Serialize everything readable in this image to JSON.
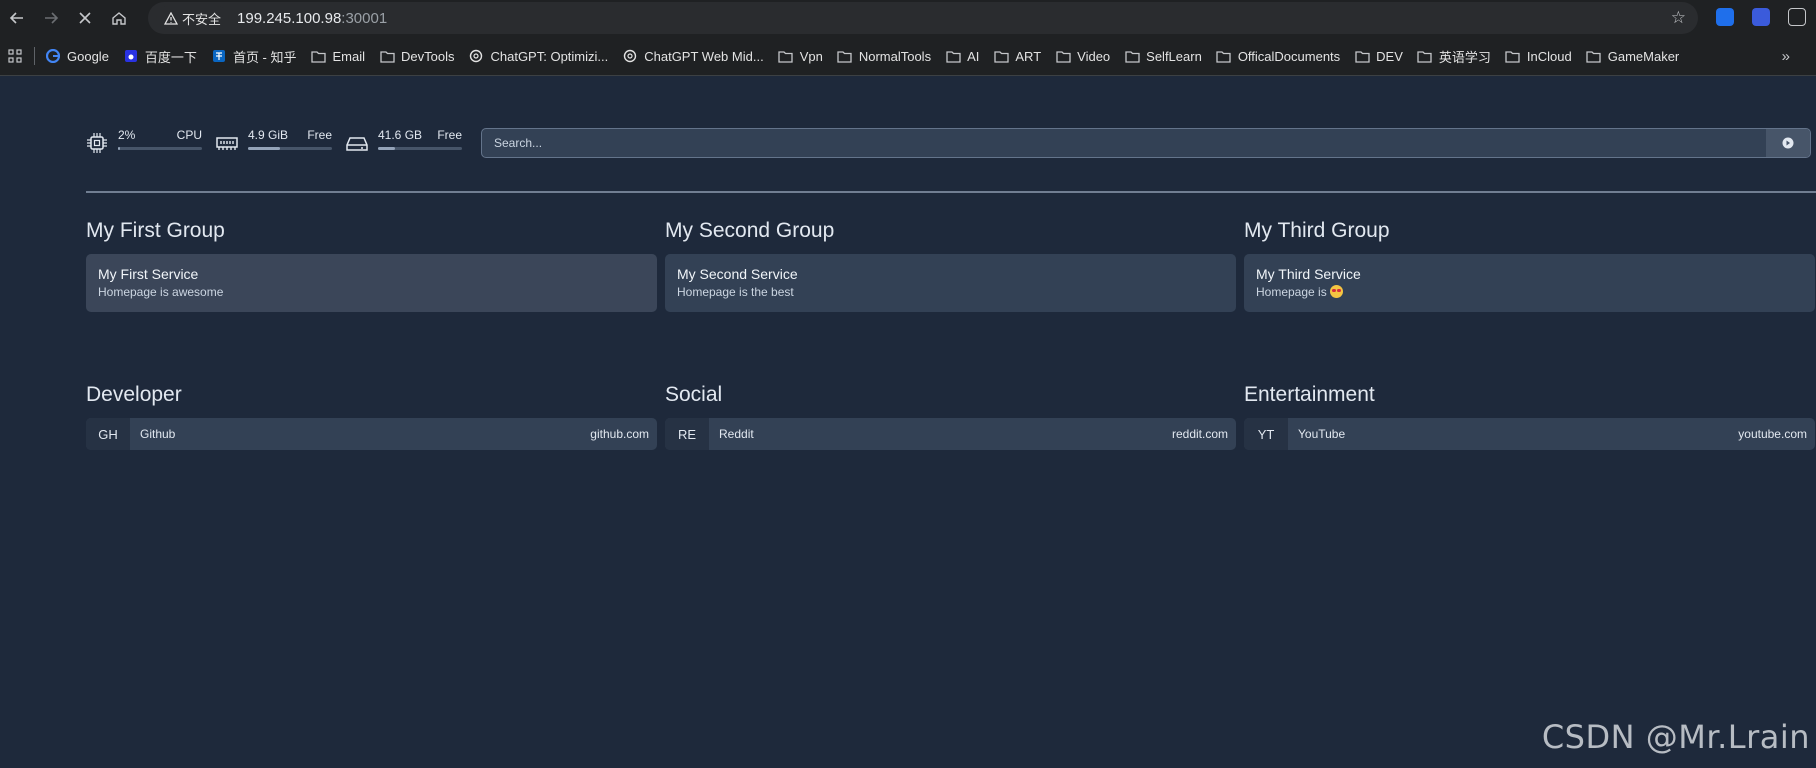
{
  "browser": {
    "security_label": "不安全",
    "url_host": "199.245.100.98",
    "url_port": ":30001",
    "bookmarks": [
      {
        "label": "Google",
        "icon": "google-icon"
      },
      {
        "label": "百度一下",
        "icon": "baidu-icon"
      },
      {
        "label": "首页 - 知乎",
        "icon": "zhihu-icon"
      },
      {
        "label": "Email",
        "icon": "folder-icon"
      },
      {
        "label": "DevTools",
        "icon": "folder-icon"
      },
      {
        "label": "ChatGPT: Optimizi...",
        "icon": "chatgpt-icon"
      },
      {
        "label": "ChatGPT Web Mid...",
        "icon": "chatgpt-icon"
      },
      {
        "label": "Vpn",
        "icon": "folder-icon"
      },
      {
        "label": "NormalTools",
        "icon": "folder-icon"
      },
      {
        "label": "AI",
        "icon": "folder-icon"
      },
      {
        "label": "ART",
        "icon": "folder-icon"
      },
      {
        "label": "Video",
        "icon": "folder-icon"
      },
      {
        "label": "SelfLearn",
        "icon": "folder-icon"
      },
      {
        "label": "OfficalDocuments",
        "icon": "folder-icon"
      },
      {
        "label": "DEV",
        "icon": "folder-icon"
      },
      {
        "label": "英语学习",
        "icon": "folder-icon"
      },
      {
        "label": "InCloud",
        "icon": "folder-icon"
      },
      {
        "label": "GameMaker",
        "icon": "folder-icon"
      }
    ]
  },
  "widgets": {
    "cpu": {
      "value": "2%",
      "label": "CPU",
      "usage": 0.02
    },
    "memory": {
      "value": "4.9 GiB",
      "label": "Free",
      "usage": 0.38
    },
    "disk": {
      "value": "41.6 GB",
      "label": "Free",
      "usage": 0.2
    }
  },
  "search": {
    "placeholder": "Search..."
  },
  "groups": [
    {
      "title": "My First Group",
      "service": {
        "name": "My First Service",
        "description": "Homepage is awesome"
      }
    },
    {
      "title": "My Second Group",
      "service": {
        "name": "My Second Service",
        "description": "Homepage is the best"
      }
    },
    {
      "title": "My Third Group",
      "service": {
        "name": "My Third Service",
        "description": "Homepage is"
      }
    }
  ],
  "bookmark_groups": [
    {
      "title": "Developer",
      "item": {
        "abbr": "GH",
        "name": "Github",
        "url": "github.com"
      }
    },
    {
      "title": "Social",
      "item": {
        "abbr": "RE",
        "name": "Reddit",
        "url": "reddit.com"
      }
    },
    {
      "title": "Entertainment",
      "item": {
        "abbr": "YT",
        "name": "YouTube",
        "url": "youtube.com"
      }
    }
  ],
  "watermark": "CSDN @Mr.Lrain",
  "colors": {
    "background": "#1e293b",
    "card": "#334155",
    "accent": "#94a3b8"
  }
}
